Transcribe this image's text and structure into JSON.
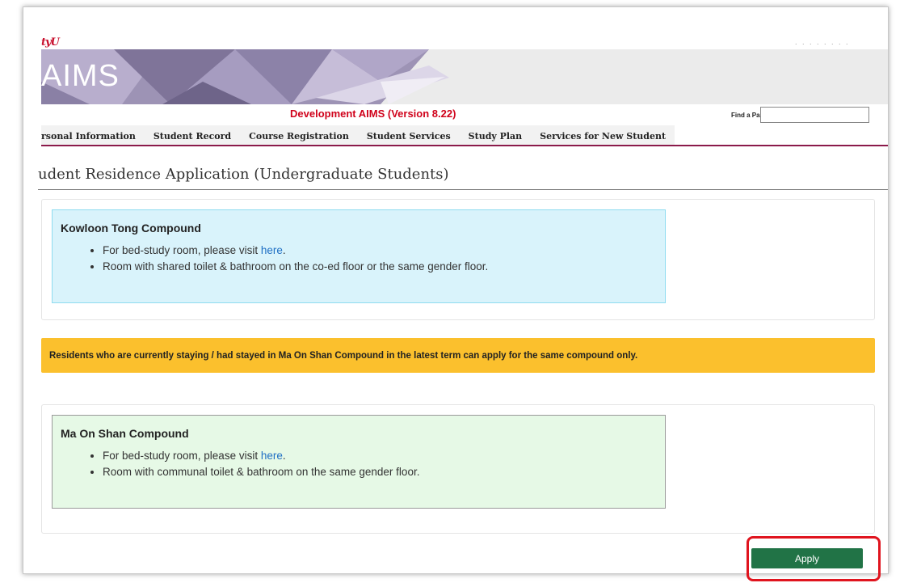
{
  "header": {
    "logo_text": "tyU",
    "top_right_text": ". . . . . . . .",
    "banner_title": "AIMS",
    "dev_title": "Development AIMS (Version 8.22)",
    "find_label": "Find a Page",
    "find_value": ""
  },
  "nav": {
    "items": [
      {
        "label": "rsonal Information"
      },
      {
        "label": "Student Record"
      },
      {
        "label": "Course Registration"
      },
      {
        "label": "Student Services"
      },
      {
        "label": "Study Plan"
      },
      {
        "label": "Services for New Student"
      }
    ]
  },
  "page": {
    "heading": "udent Residence Application (Undergraduate Students)"
  },
  "kowloon_tong": {
    "title": "Kowloon Tong Compound",
    "bullet1_prefix": "For bed-study room, please visit ",
    "bullet1_link": "here",
    "bullet1_suffix": ".",
    "bullet2": "Room with shared toilet & bathroom on the co-ed floor or the same gender floor."
  },
  "alert": {
    "text": "Residents who are currently staying / had stayed in Ma On Shan Compound in the latest term can apply for the same compound only."
  },
  "ma_on_shan": {
    "title": "Ma On Shan Compound",
    "bullet1_prefix": "For bed-study room, please visit ",
    "bullet1_link": "here",
    "bullet1_suffix": ".",
    "bullet2": "Room with communal toilet & bathroom on the same gender floor."
  },
  "actions": {
    "apply_label": "Apply"
  },
  "colors": {
    "dev_title": "#d0021b",
    "nav_underline": "#8b1a4a",
    "alert_bg": "#fbc02d",
    "apply_bg": "#217346",
    "highlight_border": "#e0141e",
    "kt_box_bg": "#d9f3fb",
    "ms_box_bg": "#e6f9e6",
    "link": "#1f6fc4"
  }
}
